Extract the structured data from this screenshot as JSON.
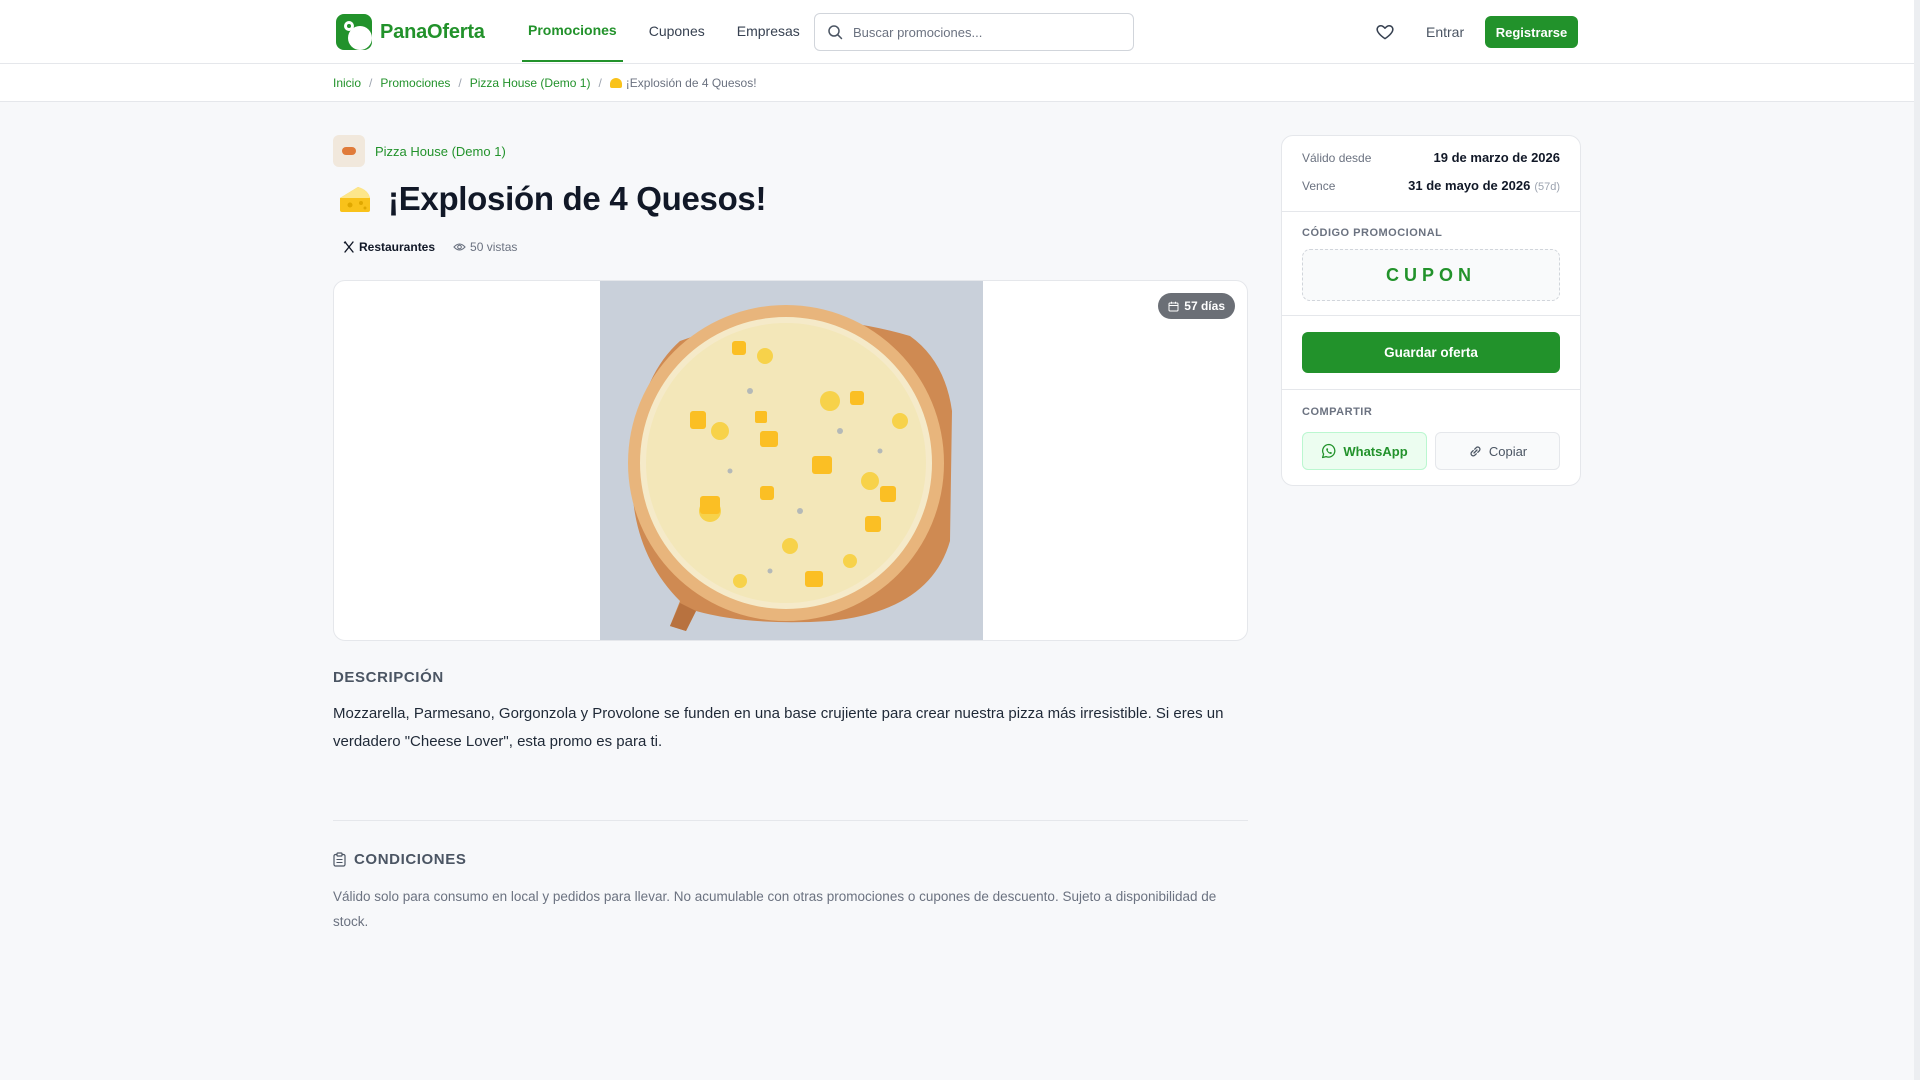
{
  "header": {
    "brand": "PanaOferta",
    "nav": [
      {
        "label": "Promociones",
        "active": true
      },
      {
        "label": "Cupones",
        "active": false
      },
      {
        "label": "Empresas",
        "active": false
      }
    ],
    "search_placeholder": "Buscar promociones...",
    "login_label": "Entrar",
    "register_label": "Registrarse",
    "brand_color": "#22922b"
  },
  "breadcrumb": {
    "items": [
      "Inicio",
      "Promociones",
      "Pizza House (Demo 1)"
    ],
    "current": "¡Explosión de 4 Quesos!"
  },
  "offer": {
    "company": "Pizza House (Demo 1)",
    "title": "¡Explosión de 4 Quesos!",
    "category": "Restaurantes",
    "views": "50 vistas",
    "days_badge": "57 días",
    "description_heading": "DESCRIPCIÓN",
    "description": "Mozzarella, Parmesano, Gorgonzola y Provolone se funden en una base crujiente para crear nuestra pizza más irresistible. Si eres un verdadero \"Cheese Lover\", esta promo es para ti.",
    "conditions_heading": "CONDICIONES",
    "conditions": "Válido solo para consumo en local y pedidos para llevar. No acumulable con otras promociones o cupones de descuento. Sujeto a disponibilidad de stock."
  },
  "sidebar": {
    "valid_from_label": "Válido desde",
    "valid_from": "19 de marzo de 2026",
    "expires_label": "Vence",
    "expires": "31 de mayo de 2026",
    "expires_days": "(57d)",
    "code_heading": "CÓDIGO PROMOCIONAL",
    "code": "CUPON",
    "save_label": "Guardar oferta",
    "share_heading": "COMPARTIR",
    "whatsapp_label": "WhatsApp",
    "copy_label": "Copiar"
  }
}
